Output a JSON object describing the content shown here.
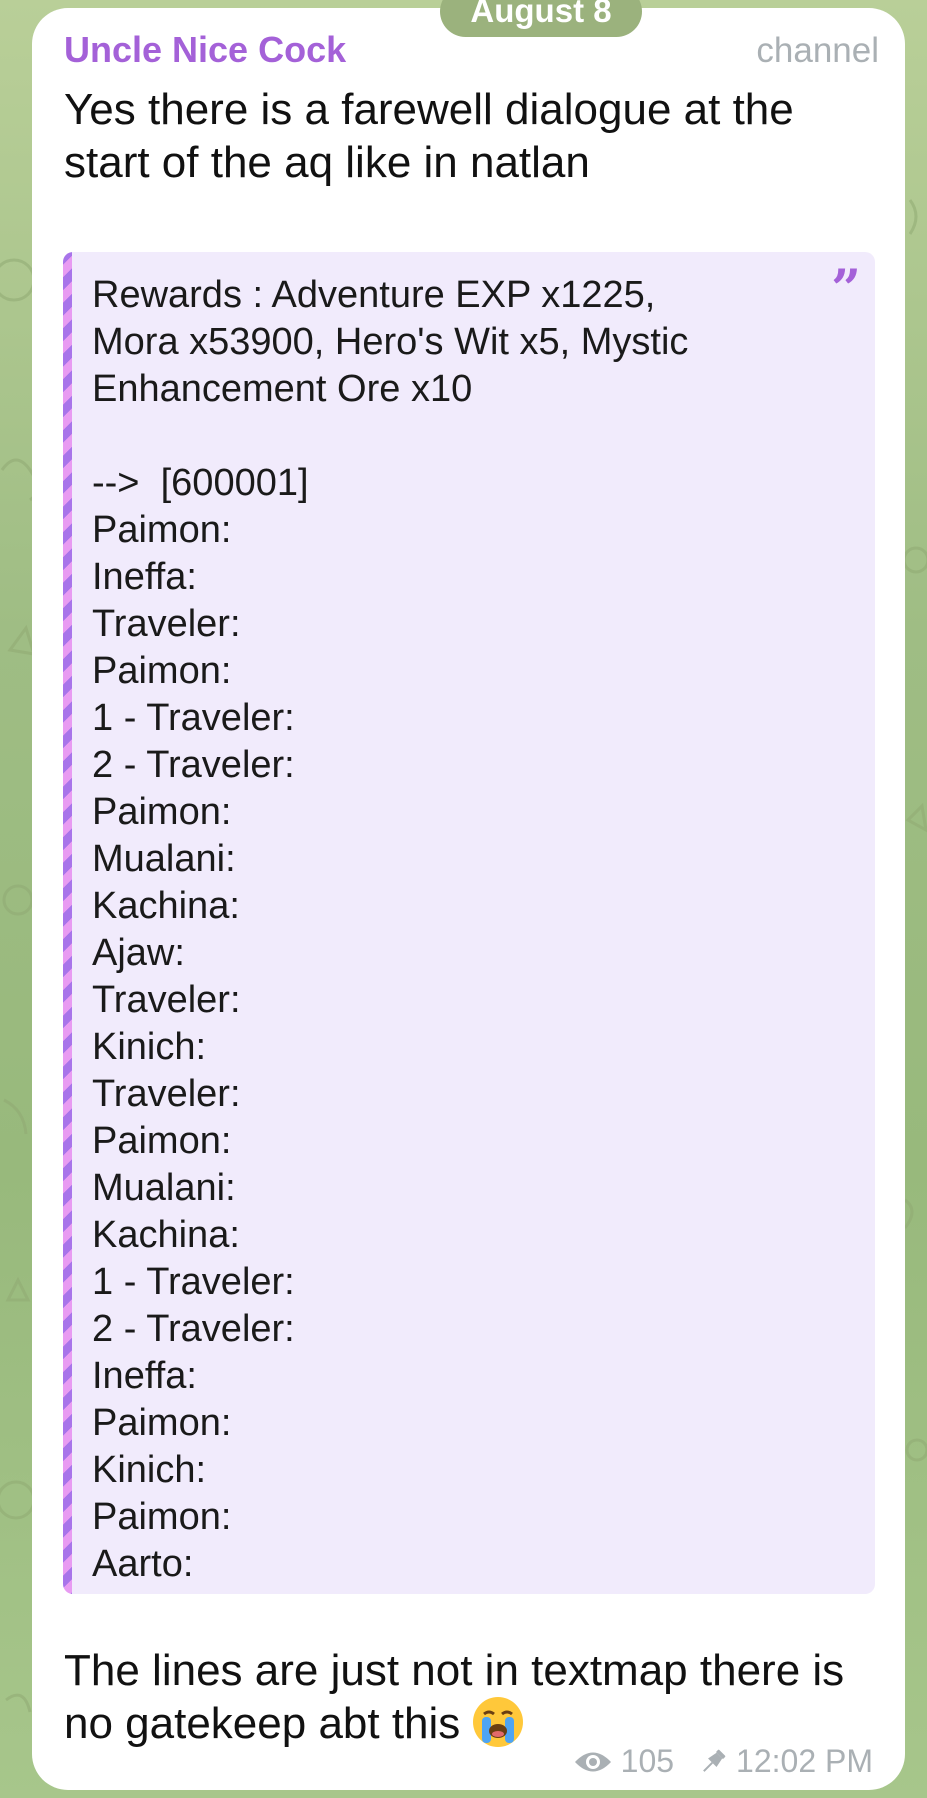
{
  "date_pill": "August 8",
  "message": {
    "sender": "Uncle Nice Cock",
    "channel_label": "channel",
    "text_top": "Yes there is a farewell dialogue at the start of the aq like in natlan",
    "quote": {
      "lines": [
        "Rewards : Adventure EXP x1225,",
        "Mora x53900, Hero's Wit x5, Mystic",
        "Enhancement Ore x10",
        "",
        "-->  [600001]",
        "Paimon:",
        "Ineffa:",
        "Traveler:",
        "Paimon:",
        "1 - Traveler:",
        "2 - Traveler:",
        "Paimon:",
        "Mualani:",
        "Kachina:",
        "Ajaw:",
        "Traveler:",
        "Kinich:",
        "Traveler:",
        "Paimon:",
        "Mualani:",
        "Kachina:",
        "1 - Traveler:",
        "2 - Traveler:",
        "Ineffa:",
        "Paimon:",
        "Kinich:",
        "Paimon:",
        "Aarto:"
      ]
    },
    "text_bottom": "The lines are just not in textmap there is no gatekeep abt this",
    "emoji": "loudly-crying-face",
    "views": "105",
    "time": "12:02 PM"
  },
  "icons": {
    "quote": "quote-icon",
    "views": "eye-icon",
    "pinned": "pin-icon"
  },
  "colors": {
    "accent": "#a461d8",
    "quote_bg": "#f1ebfc",
    "meta_gray": "#aab0b4",
    "wallpaper": "#a3c184"
  }
}
